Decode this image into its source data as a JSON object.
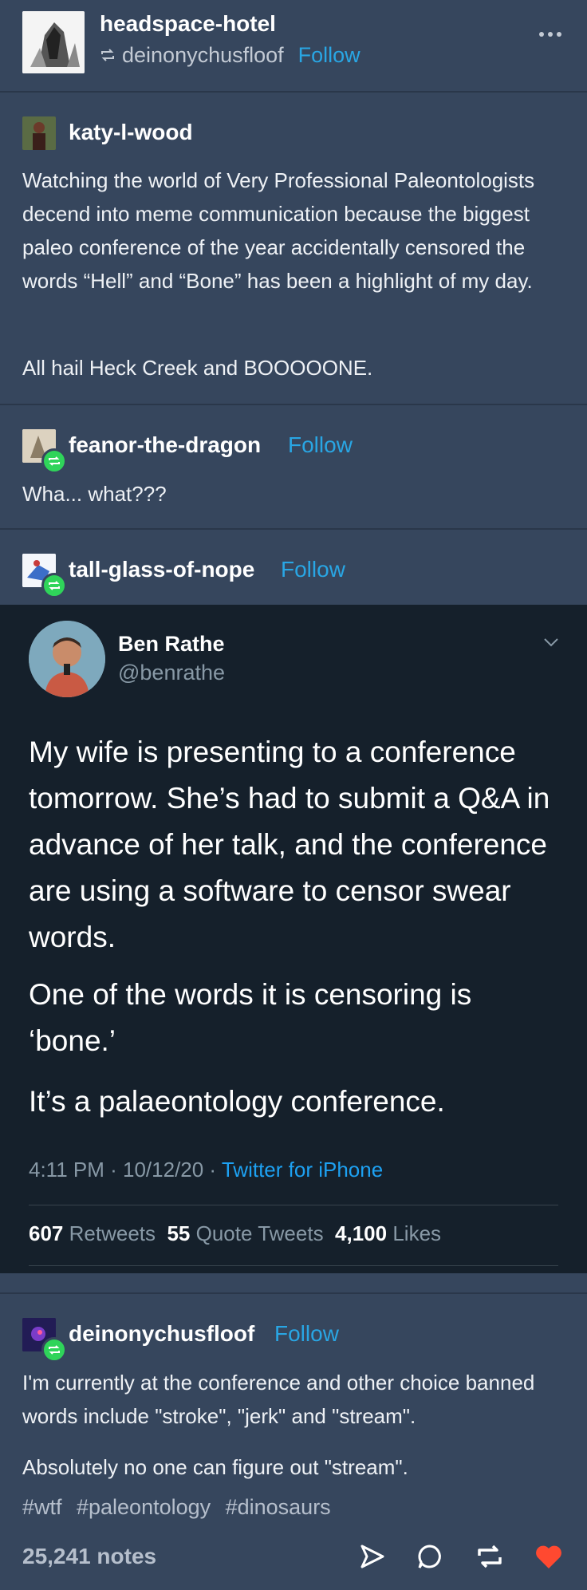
{
  "header": {
    "blog_name": "headspace-hotel",
    "reblogged_from": "deinonychusfloof",
    "follow_label": "Follow",
    "more_icon": "more-options-icon"
  },
  "post1": {
    "username": "katy-l-wood",
    "para1": "Watching the world of Very Professional Paleontologists decend into meme communication because the biggest paleo conference of the year accidentally censored the words “Hell” and “Bone” has been a highlight of my day.",
    "para2": "All hail Heck Creek and BOOOOONE."
  },
  "post2": {
    "username": "feanor-the-dragon",
    "follow_label": "Follow",
    "text": "Wha... what???"
  },
  "post3": {
    "username": "tall-glass-of-nope",
    "follow_label": "Follow"
  },
  "tweet": {
    "display_name": "Ben Rathe",
    "handle": "@benrathe",
    "para1": "My wife is presenting to a conference tomorrow. She’s had to submit a Q&A in advance of her talk, and the conference are using a software to censor swear words.",
    "para2": "One of the words it is censoring is ‘bone.’",
    "para3": "It’s a palaeontology conference.",
    "time": "4:11 PM · 10/12/20 · ",
    "source": "Twitter for iPhone",
    "retweets_count": "607",
    "retweets_label": "Retweets",
    "quotes_count": "55",
    "quotes_label": "Quote Tweets",
    "likes_count": "4,100",
    "likes_label": "Likes"
  },
  "post4": {
    "username": "deinonychusfloof",
    "follow_label": "Follow",
    "para1": "I'm currently at the conference and other choice banned words include \"stroke\", \"jerk\" and \"stream\".",
    "para2": "Absolutely no one can figure out \"stream\".",
    "tags": [
      "#wtf",
      "#paleontology",
      "#dinosaurs"
    ]
  },
  "footer": {
    "notes": "25,241 notes"
  },
  "colors": {
    "background": "#36465d",
    "tweet_bg": "#15202b",
    "follow": "#29a6e4",
    "like": "#ff4930",
    "reblog_badge": "#2fd45a"
  }
}
